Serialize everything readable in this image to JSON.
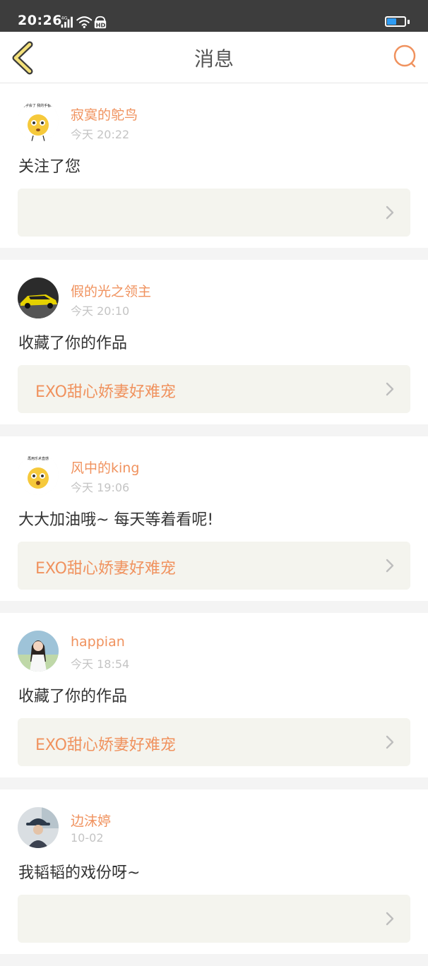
{
  "status_bar": {
    "time": "20:26",
    "network_label": "4G",
    "hd_label": "HD",
    "battery_level": 0.55,
    "battery_color": "#2f9cf3"
  },
  "header": {
    "title": "消息",
    "back_icon": "chevron-left-icon",
    "search_icon": "search-icon",
    "accent_color": "#f0925e"
  },
  "messages": [
    {
      "user": "寂寞的鸵鸟",
      "time": "今天 20:22",
      "text": "关注了您",
      "work": "",
      "avatar": "emoji-meme-avatar",
      "avatar_caption": "这也学会了 我的手都塌住"
    },
    {
      "user": "假的光之领主",
      "time": "今天 20:10",
      "text": "收藏了你的作品",
      "work": "EXO甜心娇妻好难宠",
      "avatar": "sports-car-avatar"
    },
    {
      "user": "风中的king",
      "time": "今天 19:06",
      "text": "大大加油哦~ 每天等着看呢!",
      "work": "EXO甜心娇妻好难宠",
      "avatar": "emoji-meme-avatar",
      "avatar_caption": "再用乐术直感"
    },
    {
      "user": "happian",
      "time": "今天 18:54",
      "text": "收藏了你的作品",
      "work": "EXO甜心娇妻好难宠",
      "avatar": "girl-photo-avatar"
    },
    {
      "user": "边沫婷",
      "time": "10-02",
      "text": "我韬韬的戏份呀~",
      "work": "",
      "avatar": "person-hat-avatar"
    }
  ]
}
